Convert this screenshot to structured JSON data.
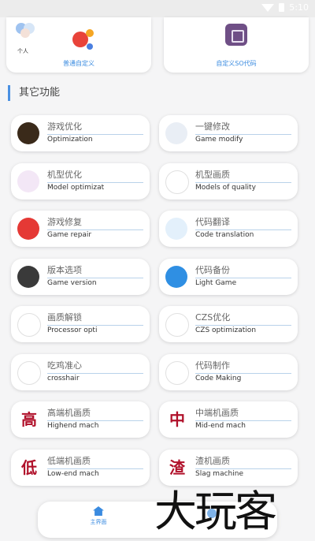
{
  "status": {
    "time": "5:10"
  },
  "top_cards": {
    "left": {
      "personal_label": "个人",
      "caption": "普通自定义"
    },
    "right": {
      "caption": "自定义SO代码"
    }
  },
  "section": {
    "title": "其它功能"
  },
  "items": [
    {
      "title": "游戏优化",
      "subtitle": "Optimization",
      "icon": "lightning-logo-icon",
      "color": "#3a2a1a"
    },
    {
      "title": "一键修改",
      "subtitle": "Game modify",
      "icon": "parachute-icon",
      "color": "#e9eef5"
    },
    {
      "title": "机型优化",
      "subtitle": "Model optimizat",
      "icon": "network-user-icon",
      "color": "#f3e7f6"
    },
    {
      "title": "机型画质",
      "subtitle": "Models of quality",
      "icon": "map-icon",
      "color": "#ffffff"
    },
    {
      "title": "游戏修复",
      "subtitle": "Game repair",
      "icon": "location-pin-icon",
      "color": "#e53935"
    },
    {
      "title": "代码翻译",
      "subtitle": "Code translation",
      "icon": "anime-character-icon",
      "color": "#e3f0fb"
    },
    {
      "title": "版本选项",
      "subtitle": "Game version",
      "icon": "flame-dark-icon",
      "color": "#3a3a3a"
    },
    {
      "title": "代码备份",
      "subtitle": "Light Game",
      "icon": "pencil-icon",
      "color": "#2f8fe3"
    },
    {
      "title": "画质解锁",
      "subtitle": "Processor opti",
      "icon": "flame-icon",
      "color": "#ffffff"
    },
    {
      "title": "CZS优化",
      "subtitle": "CZS optimization",
      "icon": "circuit-chip-icon",
      "color": "#ffffff"
    },
    {
      "title": "吃鸡准心",
      "subtitle": "crosshair",
      "icon": "helmet-icon",
      "color": "#ffffff"
    },
    {
      "title": "代码制作",
      "subtitle": "Code Making",
      "icon": "pokeball-icon",
      "color": "#ffffff"
    },
    {
      "title": "高端机画质",
      "subtitle": "Highend mach",
      "glyph": "高",
      "icon": "glyph-high-icon"
    },
    {
      "title": "中端机画质",
      "subtitle": "Mid-end mach",
      "glyph": "中",
      "icon": "glyph-mid-icon"
    },
    {
      "title": "低端机画质",
      "subtitle": "Low-end mach",
      "glyph": "低",
      "icon": "glyph-low-icon"
    },
    {
      "title": "渣机画质",
      "subtitle": "Slag machine",
      "glyph": "渣",
      "icon": "glyph-slag-icon"
    }
  ],
  "bottom_nav": {
    "home_label": "主界面"
  },
  "watermark": "大玩客"
}
